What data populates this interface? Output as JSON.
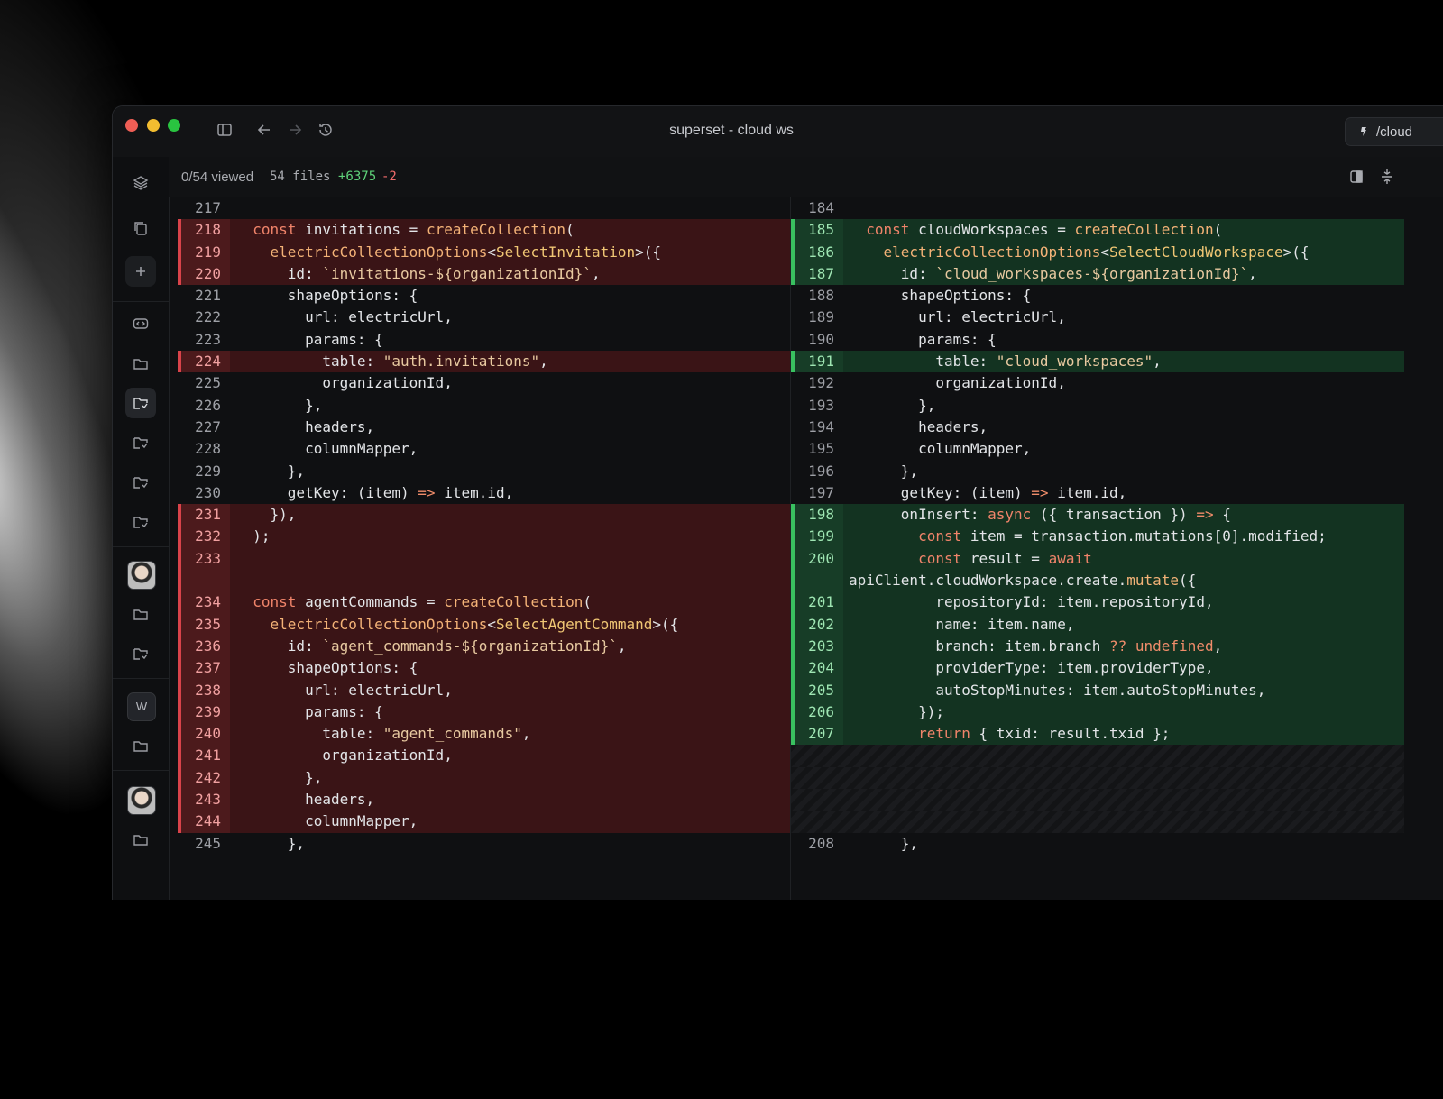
{
  "window": {
    "title": "superset - cloud ws",
    "path_label": "/cloud"
  },
  "toolbar": {
    "viewed": "0/54 viewed",
    "files": "54 files",
    "additions": "+6375",
    "deletions": "-2"
  },
  "colors": {
    "added": "#39c160",
    "deleted": "#d9434a",
    "background": "#0f1012"
  },
  "sidebar": {
    "icons": [
      "layers-icon",
      "copy-icon",
      "plus-icon",
      "code-icon",
      "folder-icon",
      "file-sync-icon",
      "file-sync-icon",
      "file-sync-icon",
      "file-sync-icon",
      "folder-icon",
      "file-sync-icon",
      "folder-icon",
      "folder-icon"
    ],
    "workspace_letter": "W"
  },
  "diff": {
    "left": [
      {
        "n": "217",
        "t": "ctx",
        "code": ""
      },
      {
        "n": "218",
        "t": "del",
        "code": "  const invitations = createCollection("
      },
      {
        "n": "219",
        "t": "del",
        "code": "    electricCollectionOptions<SelectInvitation>({"
      },
      {
        "n": "220",
        "t": "del",
        "code": "      id: `invitations-${organizationId}`,"
      },
      {
        "n": "221",
        "t": "ctx",
        "code": "      shapeOptions: {"
      },
      {
        "n": "222",
        "t": "ctx",
        "code": "        url: electricUrl,"
      },
      {
        "n": "223",
        "t": "ctx",
        "code": "        params: {"
      },
      {
        "n": "224",
        "t": "del",
        "code": "          table: \"auth.invitations\","
      },
      {
        "n": "225",
        "t": "ctx",
        "code": "          organizationId,"
      },
      {
        "n": "226",
        "t": "ctx",
        "code": "        },"
      },
      {
        "n": "227",
        "t": "ctx",
        "code": "        headers,"
      },
      {
        "n": "228",
        "t": "ctx",
        "code": "        columnMapper,"
      },
      {
        "n": "229",
        "t": "ctx",
        "code": "      },"
      },
      {
        "n": "230",
        "t": "ctx",
        "code": "      getKey: (item) => item.id,"
      },
      {
        "n": "231",
        "t": "del",
        "code": "    }),"
      },
      {
        "n": "232",
        "t": "del",
        "code": "  );"
      },
      {
        "n": "233",
        "t": "del",
        "code": ""
      },
      {
        "n": "",
        "t": "del",
        "code": ""
      },
      {
        "n": "234",
        "t": "del",
        "code": "  const agentCommands = createCollection("
      },
      {
        "n": "235",
        "t": "del",
        "code": "    electricCollectionOptions<SelectAgentCommand>({"
      },
      {
        "n": "236",
        "t": "del",
        "code": "      id: `agent_commands-${organizationId}`,"
      },
      {
        "n": "237",
        "t": "del",
        "code": "      shapeOptions: {"
      },
      {
        "n": "238",
        "t": "del",
        "code": "        url: electricUrl,"
      },
      {
        "n": "239",
        "t": "del",
        "code": "        params: {"
      },
      {
        "n": "240",
        "t": "del",
        "code": "          table: \"agent_commands\","
      },
      {
        "n": "241",
        "t": "del",
        "code": "          organizationId,"
      },
      {
        "n": "242",
        "t": "del",
        "code": "        },"
      },
      {
        "n": "243",
        "t": "del",
        "code": "        headers,"
      },
      {
        "n": "244",
        "t": "del",
        "code": "        columnMapper,"
      },
      {
        "n": "245",
        "t": "ctx",
        "code": "      },"
      }
    ],
    "right": [
      {
        "n": "184",
        "t": "ctx",
        "code": ""
      },
      {
        "n": "185",
        "t": "add",
        "code": "  const cloudWorkspaces = createCollection("
      },
      {
        "n": "186",
        "t": "add",
        "code": "    electricCollectionOptions<SelectCloudWorkspace>({"
      },
      {
        "n": "187",
        "t": "add",
        "code": "      id: `cloud_workspaces-${organizationId}`,"
      },
      {
        "n": "188",
        "t": "ctx",
        "code": "      shapeOptions: {"
      },
      {
        "n": "189",
        "t": "ctx",
        "code": "        url: electricUrl,"
      },
      {
        "n": "190",
        "t": "ctx",
        "code": "        params: {"
      },
      {
        "n": "191",
        "t": "add",
        "code": "          table: \"cloud_workspaces\","
      },
      {
        "n": "192",
        "t": "ctx",
        "code": "          organizationId,"
      },
      {
        "n": "193",
        "t": "ctx",
        "code": "        },"
      },
      {
        "n": "194",
        "t": "ctx",
        "code": "        headers,"
      },
      {
        "n": "195",
        "t": "ctx",
        "code": "        columnMapper,"
      },
      {
        "n": "196",
        "t": "ctx",
        "code": "      },"
      },
      {
        "n": "197",
        "t": "ctx",
        "code": "      getKey: (item) => item.id,"
      },
      {
        "n": "198",
        "t": "add",
        "code": "      onInsert: async ({ transaction }) => {"
      },
      {
        "n": "199",
        "t": "add",
        "code": "        const item = transaction.mutations[0].modified;"
      },
      {
        "n": "200",
        "t": "add",
        "code": "        const result = await"
      },
      {
        "n": "",
        "t": "add",
        "code": "apiClient.cloudWorkspace.create.mutate({"
      },
      {
        "n": "201",
        "t": "add",
        "code": "          repositoryId: item.repositoryId,"
      },
      {
        "n": "202",
        "t": "add",
        "code": "          name: item.name,"
      },
      {
        "n": "203",
        "t": "add",
        "code": "          branch: item.branch ?? undefined,"
      },
      {
        "n": "204",
        "t": "add",
        "code": "          providerType: item.providerType,"
      },
      {
        "n": "205",
        "t": "add",
        "code": "          autoStopMinutes: item.autoStopMinutes,"
      },
      {
        "n": "206",
        "t": "add",
        "code": "        });"
      },
      {
        "n": "207",
        "t": "add",
        "code": "        return { txid: result.txid };"
      },
      {
        "n": "",
        "t": "filler",
        "code": ""
      },
      {
        "n": "",
        "t": "filler",
        "code": ""
      },
      {
        "n": "",
        "t": "filler",
        "code": ""
      },
      {
        "n": "",
        "t": "filler",
        "code": ""
      },
      {
        "n": "208",
        "t": "ctx",
        "code": "      },"
      }
    ]
  }
}
